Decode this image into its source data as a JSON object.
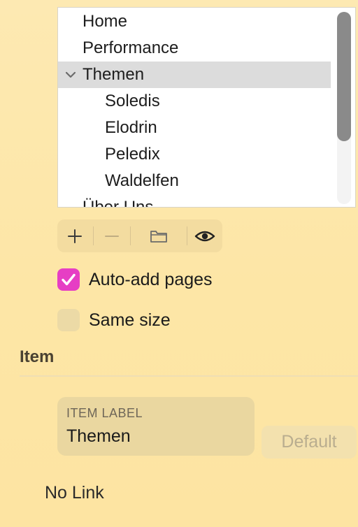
{
  "tree": {
    "items": [
      {
        "label": "Home"
      },
      {
        "label": "Performance"
      },
      {
        "label": "Themen",
        "expanded": true,
        "selected": true
      },
      {
        "label": "Soledis"
      },
      {
        "label": "Elodrin"
      },
      {
        "label": "Peledix"
      },
      {
        "label": "Waldelfen"
      },
      {
        "label": "Über Uns"
      }
    ],
    "disclosure_icon": "chevron-down-icon"
  },
  "toolbar": {
    "buttons": [
      {
        "icon": "plus-icon",
        "enabled": true
      },
      {
        "icon": "minus-icon",
        "enabled": false
      },
      {
        "icon": "folder-icon",
        "enabled": true
      },
      {
        "icon": "eye-icon",
        "enabled": true
      }
    ]
  },
  "options": {
    "auto_add": {
      "label": "Auto-add pages",
      "checked": true
    },
    "same_size": {
      "label": "Same size",
      "checked": false
    }
  },
  "item_section": {
    "title": "Item",
    "field_caption": "ITEM LABEL",
    "field_value": "Themen",
    "default_button": "Default",
    "link_text": "No Link"
  },
  "colors": {
    "accent": "#e63ec4",
    "background": "#fde8ad",
    "selection": "#dcdcdc"
  }
}
